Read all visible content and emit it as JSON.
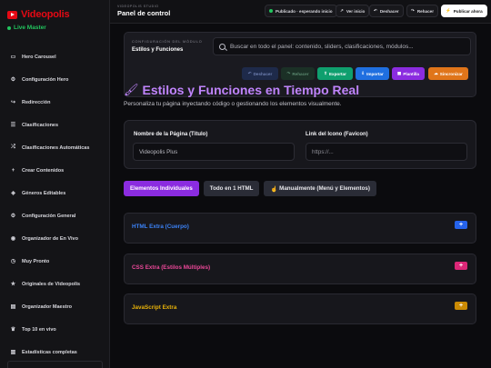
{
  "brand": {
    "name": "Videopolis",
    "sub": "Live Master"
  },
  "sidebar": {
    "items": [
      {
        "icon": "image-icon",
        "glyph": "▭",
        "label": "Hero Carousel"
      },
      {
        "icon": "gear-icon",
        "glyph": "⚙",
        "label": "Configuración Hero"
      },
      {
        "icon": "redirect-icon",
        "glyph": "↪",
        "label": "Redirección"
      },
      {
        "icon": "list-icon",
        "glyph": "☰",
        "label": "Clasificaciones"
      },
      {
        "icon": "shuffle-icon",
        "glyph": "⤮",
        "label": "Clasificaciones Automáticas"
      },
      {
        "icon": "plus-icon",
        "glyph": "+",
        "label": "Crear Contenidos"
      },
      {
        "icon": "tag-icon",
        "glyph": "◈",
        "label": "Géneros Editables"
      },
      {
        "icon": "settings-icon",
        "glyph": "⚙",
        "label": "Configuración General"
      },
      {
        "icon": "broadcast-icon",
        "glyph": "◉",
        "label": "Organizador de En Vivo"
      },
      {
        "icon": "clock-icon",
        "glyph": "◷",
        "label": "Muy Pronto"
      },
      {
        "icon": "star-icon",
        "glyph": "★",
        "label": "Originales de Videopolis"
      },
      {
        "icon": "organizer-icon",
        "glyph": "▤",
        "label": "Organizador Maestro"
      },
      {
        "icon": "trophy-icon",
        "glyph": "♛",
        "label": "Top 10 en vivo"
      },
      {
        "icon": "chart-icon",
        "glyph": "▥",
        "label": "Estadísticas completas"
      }
    ]
  },
  "topbar": {
    "studio": "VIDEOPOLIS STUDIO",
    "title": "Panel de control",
    "status": "Publicado · esperando inicio",
    "view_home": "Ver inicio",
    "undo": "Deshacer",
    "redo": "Rehacer",
    "publish": "Publicar ahora"
  },
  "config": {
    "kicker": "CONFIGURACIÓN DEL MÓDULO",
    "title": "Estilos y Funciones",
    "search_placeholder": "Buscar en todo el panel: contenido, sliders, clasificaciones, módulos...",
    "actions": {
      "undo": "Deshacer",
      "redo": "Rehacer",
      "export": "Exportar",
      "import": "Importar",
      "template": "Plantilla",
      "sync": "Sincronizar"
    }
  },
  "page": {
    "heading": "Estilos y Funciones en Tiempo Real",
    "subtitle": "Personaliza tu página inyectando código o gestionando los elementos visualmente."
  },
  "fields": {
    "page_name_label": "Nombre de la Página (Título)",
    "page_name_value": "Videopolis Plus",
    "favicon_label": "Link del Icono (Favicon)",
    "favicon_placeholder": "https://..."
  },
  "tabs": [
    "Elementos Individuales",
    "Todo en 1 HTML",
    "Manualmente (Menú y Elementos)"
  ],
  "accordions": [
    {
      "title": "HTML Extra (Cuerpo)",
      "color": "#3b82f6",
      "button_color": "#2563eb"
    },
    {
      "title": "CSS Extra (Estilos Múltiples)",
      "color": "#ec4899",
      "button_color": "#db2777"
    },
    {
      "title": "JavaScript Extra",
      "color": "#eab308",
      "button_color": "#ca8a04"
    }
  ]
}
